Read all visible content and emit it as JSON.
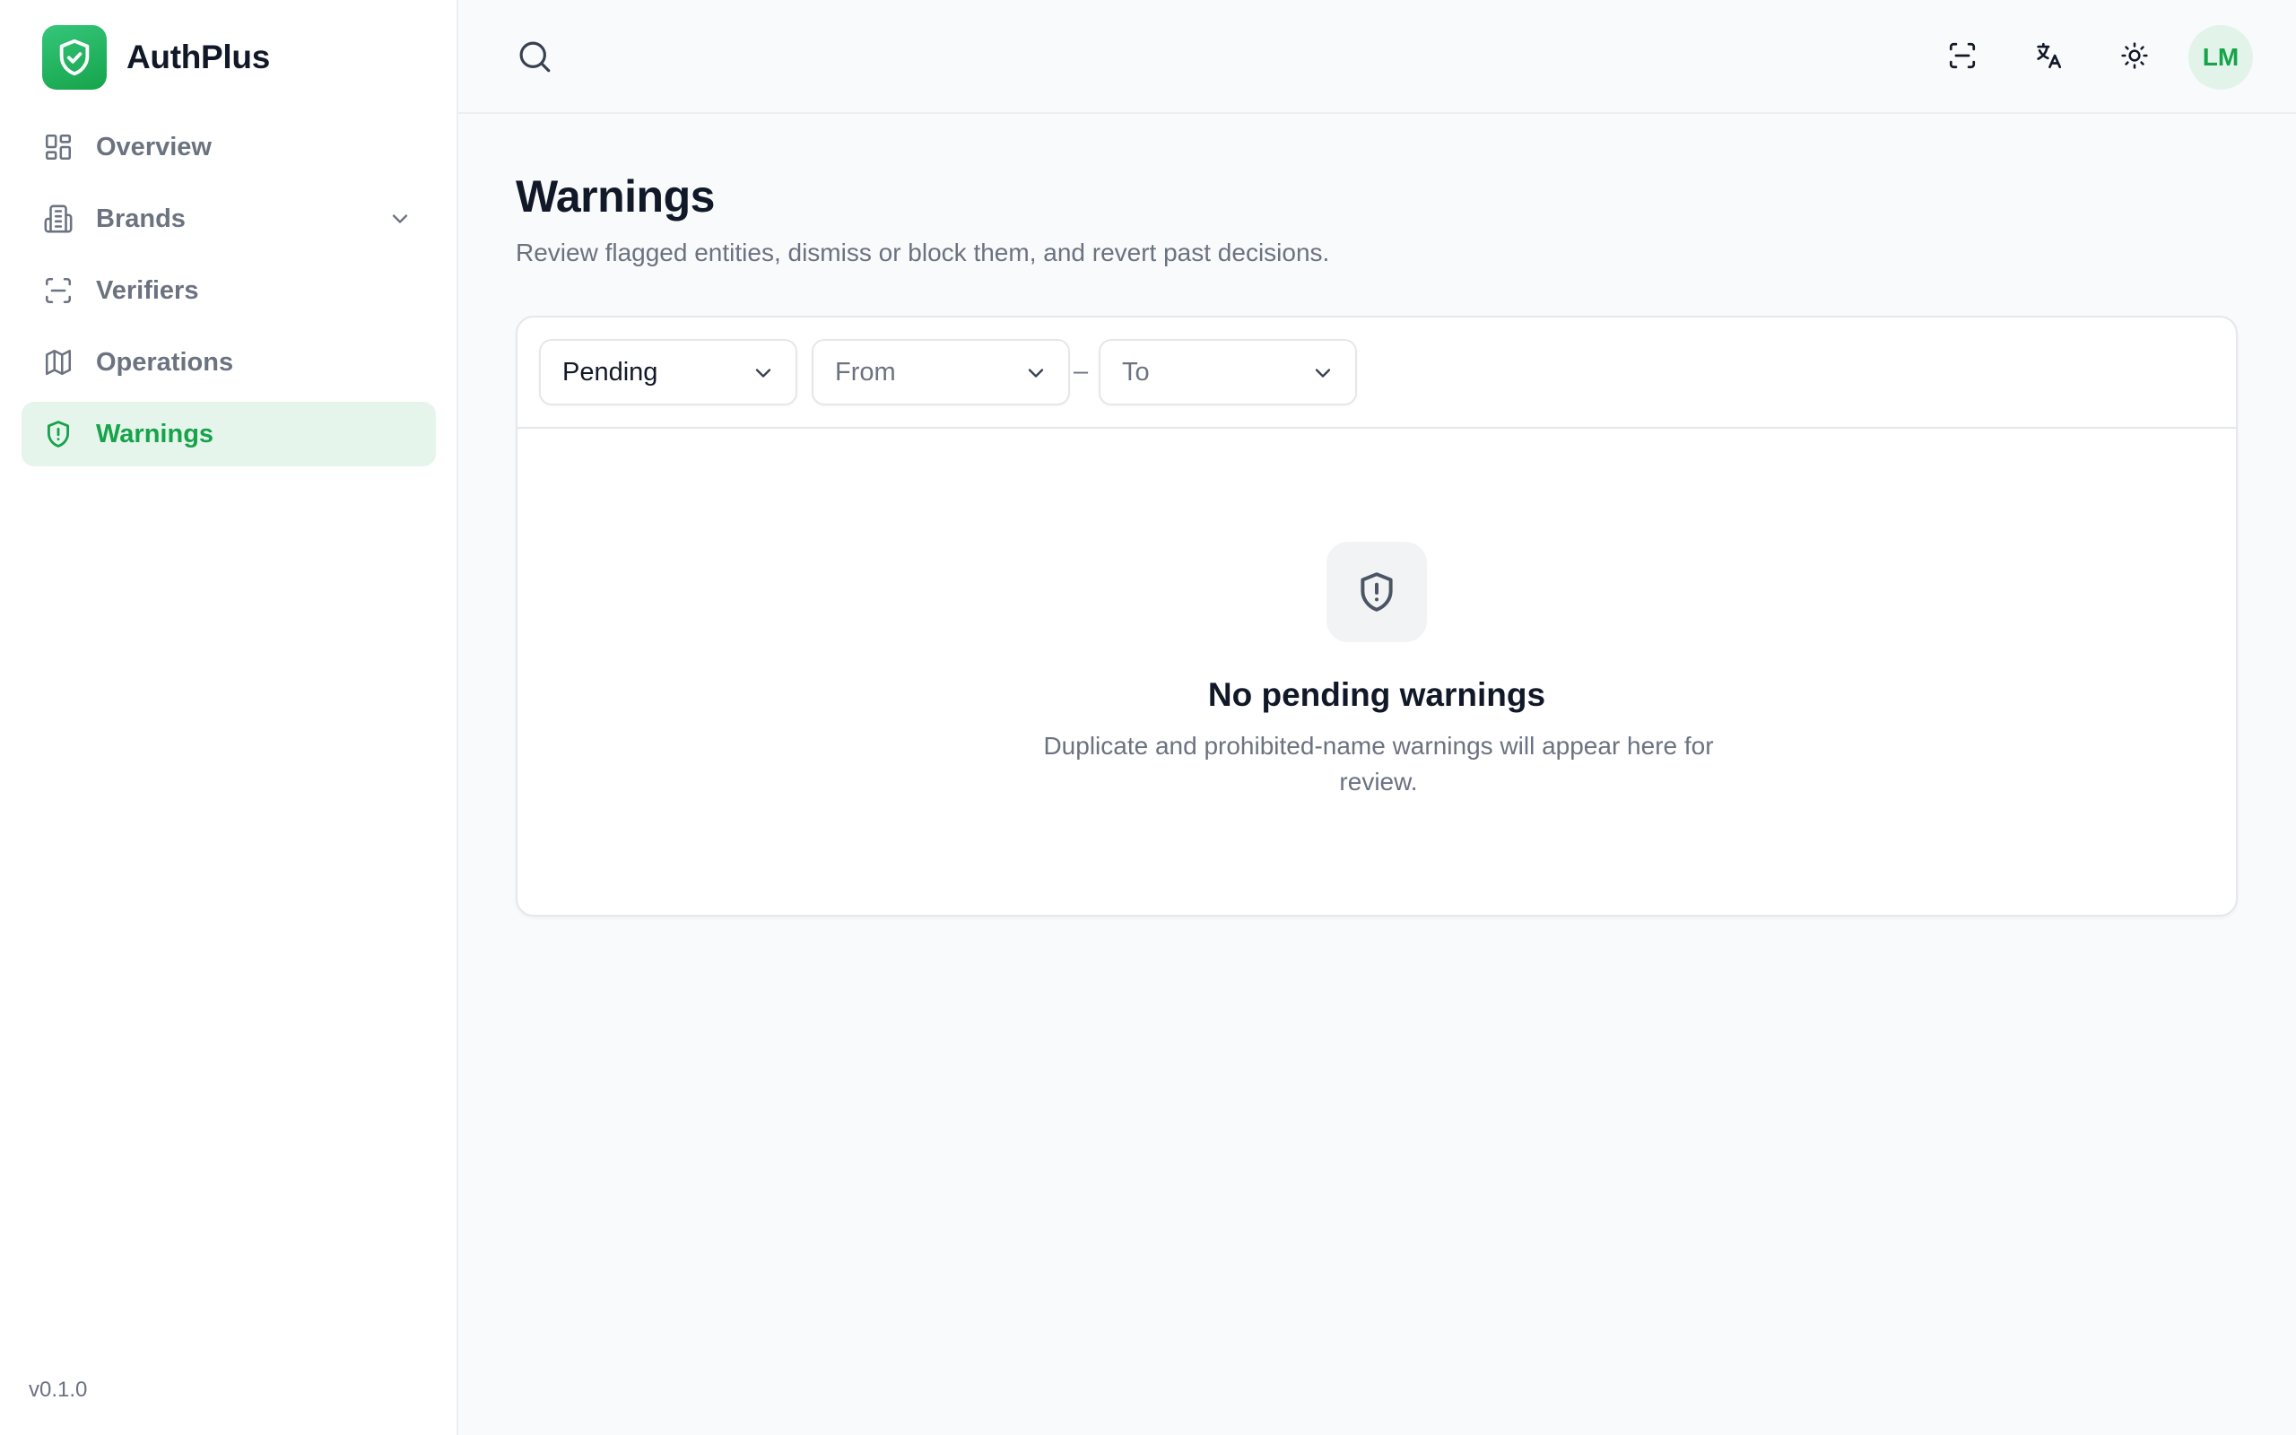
{
  "app": {
    "name": "AuthPlus",
    "version": "v0.1.0"
  },
  "sidebar": {
    "items": [
      {
        "label": "Overview",
        "icon": "grid-icon"
      },
      {
        "label": "Brands",
        "icon": "building-icon",
        "expandable": true
      },
      {
        "label": "Verifiers",
        "icon": "scan-icon"
      },
      {
        "label": "Operations",
        "icon": "map-icon"
      },
      {
        "label": "Warnings",
        "icon": "shield-alert-icon",
        "active": true
      }
    ]
  },
  "topbar": {
    "search_icon": "search-icon",
    "actions": [
      "scan-icon",
      "translate-icon",
      "sun-icon"
    ],
    "avatar_initials": "LM"
  },
  "page": {
    "title": "Warnings",
    "subtitle": "Review flagged entities, dismiss or block them, and revert past decisions."
  },
  "filters": {
    "status": "Pending",
    "from_placeholder": "From",
    "separator": "–",
    "to_placeholder": "To"
  },
  "empty_state": {
    "icon": "shield-alert-icon",
    "title": "No pending warnings",
    "description": "Duplicate and prohibited-name warnings will appear here for review."
  },
  "colors": {
    "accent": "#16a34a",
    "accent_bg": "#e6f5ec",
    "muted_text": "#6b7280",
    "border": "#e5e7eb"
  }
}
